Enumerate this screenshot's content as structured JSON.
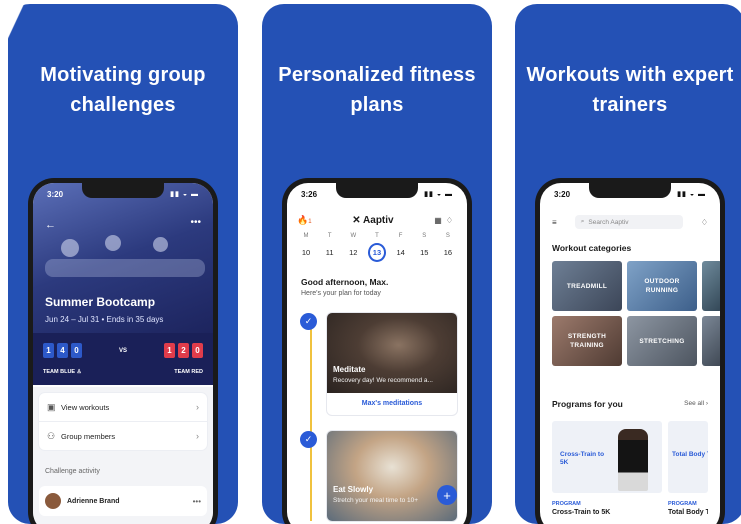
{
  "panels": [
    {
      "headline": "Motivating group challenges",
      "status_time": "3:20",
      "challenge": {
        "title": "Summer Bootcamp",
        "subtitle": "Jun 24 – Jul 31  •  Ends in 35 days",
        "team_blue_score": [
          "1",
          "4",
          "0"
        ],
        "team_red_score": [
          "1",
          "2",
          "0"
        ],
        "vs": "VS",
        "team_blue": "TEAM BLUE",
        "team_red": "TEAM RED"
      },
      "menu": [
        {
          "label": "View workouts",
          "icon": "dumbbell-icon"
        },
        {
          "label": "Group members",
          "icon": "people-icon"
        }
      ],
      "activity_label": "Challenge activity",
      "activity_name": "Adrienne Brand"
    },
    {
      "headline": "Personalized fitness plans",
      "status_time": "3:26",
      "streak": "1",
      "logo": "Aaptiv",
      "days": [
        {
          "letter": "M",
          "num": "10"
        },
        {
          "letter": "T",
          "num": "11"
        },
        {
          "letter": "W",
          "num": "12"
        },
        {
          "letter": "T",
          "num": "13",
          "selected": true
        },
        {
          "letter": "F",
          "num": "14"
        },
        {
          "letter": "S",
          "num": "15"
        },
        {
          "letter": "S",
          "num": "16"
        }
      ],
      "greeting": "Good afternoon, Max.",
      "plan_text": "Here's your plan for today",
      "cards": [
        {
          "title": "Meditate",
          "subtitle": "Recovery day! We recommend a...",
          "link": "Max's meditations"
        },
        {
          "title": "Eat Slowly",
          "subtitle": "Stretch your meal time to 10+"
        }
      ]
    },
    {
      "headline": "Workouts with expert trainers",
      "status_time": "3:20",
      "search_placeholder": "Search Aaptiv",
      "categories_title": "Workout categories",
      "categories": [
        "TREADMILL",
        "OUTDOOR RUNNING",
        "STRENGTH TRAINING",
        "STRETCHING"
      ],
      "programs_title": "Programs for you",
      "see_all": "See all",
      "programs": [
        {
          "image_text": "Cross-Train to 5K",
          "tag": "PROGRAM",
          "name": "Cross-Train to 5K"
        },
        {
          "image_text": "Total Body T",
          "tag": "PROGRAM",
          "name": "Total Body T"
        }
      ]
    }
  ],
  "colors": {
    "brand_blue": "#2451b5",
    "accent_blue": "#2a5bd7",
    "team_red": "#e03c4b",
    "timeline_yellow": "#f0c23e"
  }
}
